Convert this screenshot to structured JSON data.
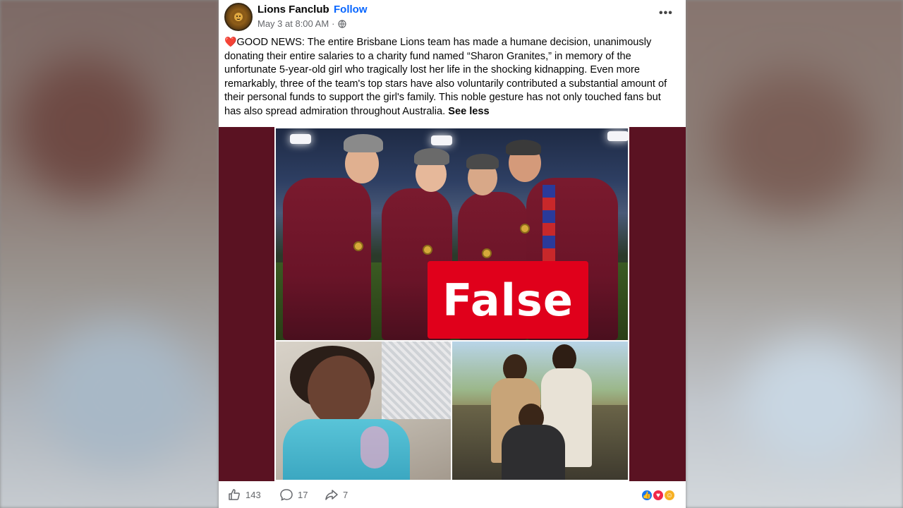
{
  "post": {
    "page_name": "Lions Fanclub",
    "separator": "·",
    "follow_label": "Follow",
    "timestamp": "May 3 at 8:00 AM",
    "meta_separator": "·",
    "body_text": "GOOD NEWS: The entire Brisbane Lions team has made a humane decision, unanimously donating their entire salaries to a charity fund named “Sharon Granites,” in memory of the unfortunate 5-year-old girl who tragically lost her life in the shocking kidnapping. Even more remarkably, three of the team's top stars have also voluntarily contributed a substantial amount of their personal funds to support the girl's family. This noble gesture has not only touched fans but has also spread admiration throughout Australia.",
    "see_less_label": "See less",
    "badge_label": "False",
    "more_icon": "more-horizontal-icon",
    "colors": {
      "media_frame": "#5a1222",
      "badge": "#e0001b",
      "follow": "#0866ff"
    }
  },
  "footer": {
    "likes_count": "143",
    "comments_count": "17",
    "shares_count": "7",
    "reactions": [
      "like-reaction-icon",
      "love-reaction-icon",
      "care-reaction-icon"
    ]
  }
}
